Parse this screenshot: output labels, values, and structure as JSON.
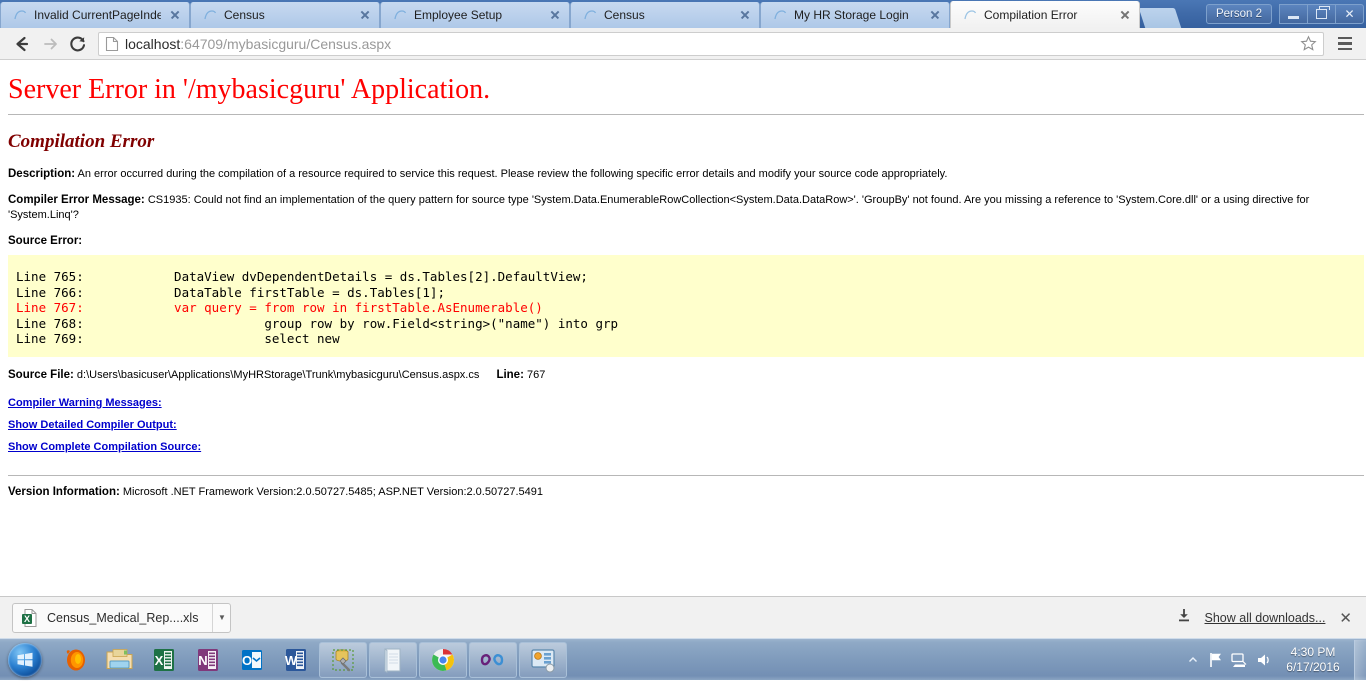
{
  "browser": {
    "tabs": [
      {
        "title": "Invalid CurrentPageIndex",
        "active": false,
        "favicon": "page-favicon"
      },
      {
        "title": "Census",
        "active": false,
        "favicon": "page-favicon"
      },
      {
        "title": "Employee Setup",
        "active": false,
        "favicon": "page-favicon"
      },
      {
        "title": "Census",
        "active": false,
        "favicon": "page-favicon"
      },
      {
        "title": "My HR Storage Login",
        "active": false,
        "favicon": "page-favicon"
      },
      {
        "title": "Compilation Error",
        "active": true,
        "favicon": "page-favicon"
      }
    ],
    "new_tab_label": "",
    "profile_button": "Person 2",
    "window_controls": {
      "minimize": "minimize-icon",
      "restore": "restore-icon",
      "close": "✕"
    },
    "toolbar": {
      "back": "back-arrow-icon",
      "forward": "forward-arrow-icon",
      "reload": "reload-icon",
      "url_host": "localhost",
      "url_rest": ":64709/mybasicguru/Census.aspx",
      "url_full": "localhost:64709/mybasicguru/Census.aspx",
      "bookmark": "star-icon",
      "menu": "hamburger-menu-icon"
    }
  },
  "page": {
    "title": "Server Error in '/mybasicguru' Application.",
    "subtitle": "Compilation Error",
    "description_label": "Description:",
    "description_text": "An error occurred during the compilation of a resource required to service this request. Please review the following specific error details and modify your source code appropriately.",
    "compiler_error_label": "Compiler Error Message:",
    "compiler_error_text": "CS1935: Could not find an implementation of the query pattern for source type 'System.Data.EnumerableRowCollection<System.Data.DataRow>'. 'GroupBy' not found. Are you missing a reference to 'System.Core.dll' or a using directive for 'System.Linq'?",
    "source_error_label": "Source Error:",
    "code_lines": [
      {
        "num": "Line 765:",
        "code": "            DataView dvDependentDetails = ds.Tables[2].DefaultView;",
        "error": false
      },
      {
        "num": "Line 766:",
        "code": "            DataTable firstTable = ds.Tables[1];",
        "error": false
      },
      {
        "num": "Line 767:",
        "code": "            var query = from row in firstTable.AsEnumerable()",
        "error": true
      },
      {
        "num": "Line 768:",
        "code": "                        group row by row.Field<string>(\"name\") into grp",
        "error": false
      },
      {
        "num": "Line 769:",
        "code": "                        select new",
        "error": false
      }
    ],
    "source_file_label": "Source File:",
    "source_file_value": "d:\\Users\\basicuser\\Applications\\MyHRStorage\\Trunk\\mybasicguru\\Census.aspx.cs",
    "line_label": "Line:",
    "line_value": "767",
    "links": [
      "Compiler Warning Messages:",
      "Show Detailed Compiler Output:",
      "Show Complete Compilation Source:"
    ],
    "version_label": "Version Information:",
    "version_text": "Microsoft .NET Framework Version:2.0.50727.5485; ASP.NET Version:2.0.50727.5491",
    "colors": {
      "error_red": "#ff0000",
      "subtitle_maroon": "#800000",
      "code_background": "#ffffcc",
      "link_blue": "#0000cc"
    }
  },
  "downloads": {
    "file_name": "Census_Medical_Rep....xls",
    "file_icon": "excel-file-icon",
    "caret": "▼",
    "show_all_label": "Show all downloads...",
    "show_all_icon": "download-arrow-icon",
    "close_label": "✕"
  },
  "taskbar": {
    "start_label": "start-orb-icon",
    "items": [
      {
        "name": "firefox-icon",
        "boxed": false
      },
      {
        "name": "file-explorer-icon",
        "boxed": false
      },
      {
        "name": "excel-icon",
        "boxed": false
      },
      {
        "name": "onenote-icon",
        "boxed": false
      },
      {
        "name": "outlook-icon",
        "boxed": false
      },
      {
        "name": "word-icon",
        "boxed": false
      },
      {
        "name": "sql-server-tool-icon",
        "boxed": true
      },
      {
        "name": "notepad-icon",
        "boxed": true
      },
      {
        "name": "chrome-icon",
        "boxed": true
      },
      {
        "name": "visual-studio-icon",
        "boxed": true
      },
      {
        "name": "remote-desktop-icon",
        "boxed": true
      }
    ],
    "tray": {
      "arrow": "show-hidden-icons-arrow",
      "network": "network-icon",
      "action": "action-center-flag-icon",
      "volume": "volume-icon",
      "time": "4:30 PM",
      "date": "6/17/2016"
    }
  }
}
